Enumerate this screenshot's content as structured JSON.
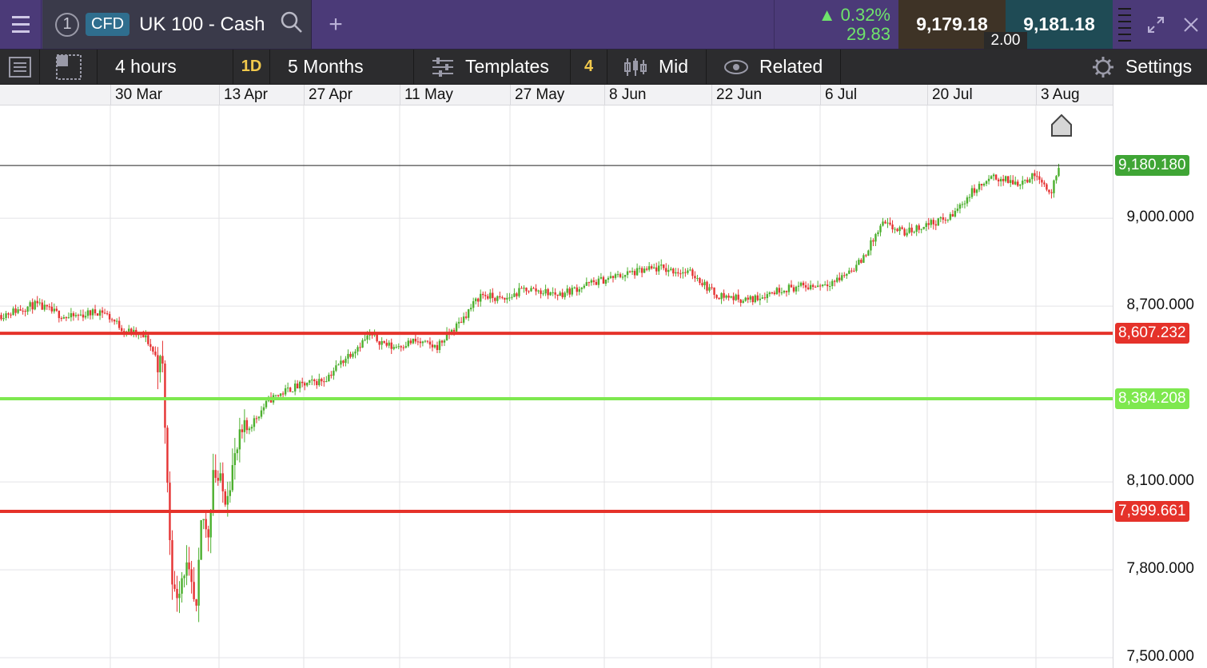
{
  "header": {
    "instrument_index": "1",
    "instrument_type": "CFD",
    "instrument_name": "UK 100 - Cash",
    "add_tab": "+",
    "change_pct": "0.32%",
    "change_abs": "29.83",
    "sell_price": "9,179.18",
    "buy_price": "9,181.18",
    "spread": "2.00"
  },
  "toolbar": {
    "interval": "4 hours",
    "range_badge": "1D",
    "range": "5 Months",
    "templates": "Templates",
    "templates_count": "4",
    "price_type": "Mid",
    "related": "Related",
    "settings": "Settings"
  },
  "colors": {
    "up": "#4caf2e",
    "down": "#e53232",
    "support_red": "#e5322a",
    "support_green": "#7ee84f",
    "current_green": "#3fa535"
  },
  "chart_data": {
    "type": "candlestick",
    "x_ticks": [
      "30 Mar",
      "13 Apr",
      "27 Apr",
      "11 May",
      "27 May",
      "8 Jun",
      "22 Jun",
      "6 Jul",
      "20 Jul",
      "3 Aug"
    ],
    "y_ticks": [
      "9,000.000",
      "8,700.000",
      "8,100.000",
      "7,800.000",
      "7,500.000"
    ],
    "y_tick_values": [
      9000,
      8700,
      8100,
      7800,
      7500
    ],
    "ylim": [
      7465,
      9385
    ],
    "current_price": {
      "label": "9,180.180",
      "value": 9180.18
    },
    "horizontal_lines": [
      {
        "label": "8,607.232",
        "value": 8607.232,
        "color": "red"
      },
      {
        "label": "8,384.208",
        "value": 8384.208,
        "color": "green"
      },
      {
        "label": "7,999.661",
        "value": 7999.661,
        "color": "red"
      }
    ],
    "trend": [
      {
        "x": 0.0,
        "y": 8670
      },
      {
        "x": 0.03,
        "y": 8705
      },
      {
        "x": 0.06,
        "y": 8660
      },
      {
        "x": 0.09,
        "y": 8685
      },
      {
        "x": 0.11,
        "y": 8620
      },
      {
        "x": 0.13,
        "y": 8590
      },
      {
        "x": 0.145,
        "y": 8480
      },
      {
        "x": 0.15,
        "y": 7980
      },
      {
        "x": 0.155,
        "y": 7700
      },
      {
        "x": 0.165,
        "y": 7820
      },
      {
        "x": 0.175,
        "y": 7640
      },
      {
        "x": 0.18,
        "y": 8000
      },
      {
        "x": 0.185,
        "y": 7900
      },
      {
        "x": 0.19,
        "y": 8150
      },
      {
        "x": 0.2,
        "y": 8050
      },
      {
        "x": 0.215,
        "y": 8250
      },
      {
        "x": 0.24,
        "y": 8380
      },
      {
        "x": 0.26,
        "y": 8420
      },
      {
        "x": 0.29,
        "y": 8450
      },
      {
        "x": 0.31,
        "y": 8530
      },
      {
        "x": 0.33,
        "y": 8600
      },
      {
        "x": 0.35,
        "y": 8560
      },
      {
        "x": 0.37,
        "y": 8580
      },
      {
        "x": 0.39,
        "y": 8560
      },
      {
        "x": 0.41,
        "y": 8640
      },
      {
        "x": 0.43,
        "y": 8740
      },
      {
        "x": 0.45,
        "y": 8720
      },
      {
        "x": 0.47,
        "y": 8760
      },
      {
        "x": 0.5,
        "y": 8740
      },
      {
        "x": 0.53,
        "y": 8780
      },
      {
        "x": 0.56,
        "y": 8810
      },
      {
        "x": 0.59,
        "y": 8830
      },
      {
        "x": 0.62,
        "y": 8810
      },
      {
        "x": 0.64,
        "y": 8740
      },
      {
        "x": 0.67,
        "y": 8720
      },
      {
        "x": 0.7,
        "y": 8760
      },
      {
        "x": 0.73,
        "y": 8770
      },
      {
        "x": 0.75,
        "y": 8790
      },
      {
        "x": 0.77,
        "y": 8850
      },
      {
        "x": 0.79,
        "y": 8980
      },
      {
        "x": 0.81,
        "y": 8950
      },
      {
        "x": 0.83,
        "y": 8980
      },
      {
        "x": 0.85,
        "y": 9000
      },
      {
        "x": 0.87,
        "y": 9090
      },
      {
        "x": 0.89,
        "y": 9140
      },
      {
        "x": 0.91,
        "y": 9120
      },
      {
        "x": 0.93,
        "y": 9150
      },
      {
        "x": 0.94,
        "y": 9080
      },
      {
        "x": 0.95,
        "y": 9180
      }
    ]
  }
}
